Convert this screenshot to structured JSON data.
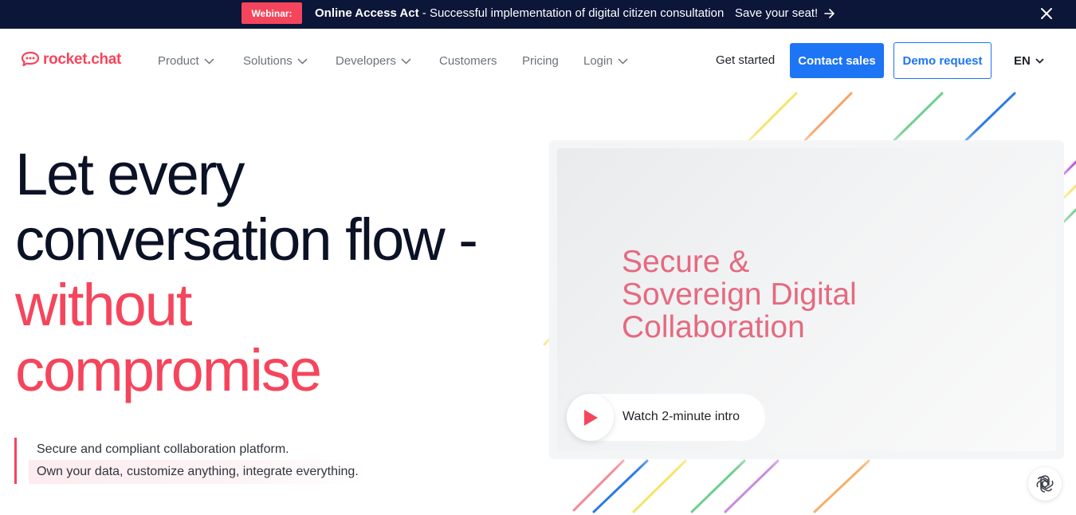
{
  "announcement": {
    "badge": "Webinar:",
    "title": "Online Access Act",
    "message": " - Successful implementation of digital citizen consultation",
    "cta": "Save your seat!",
    "close_icon": "close-icon"
  },
  "header": {
    "logo_text": "rocket.chat",
    "nav": [
      {
        "label": "Product",
        "has_dropdown": true
      },
      {
        "label": "Solutions",
        "has_dropdown": true
      },
      {
        "label": "Developers",
        "has_dropdown": true
      },
      {
        "label": "Customers",
        "has_dropdown": false
      },
      {
        "label": "Pricing",
        "has_dropdown": false
      },
      {
        "label": "Login",
        "has_dropdown": true
      }
    ],
    "get_started": "Get started",
    "contact_sales": "Contact sales",
    "demo_request": "Demo request",
    "language": "EN"
  },
  "hero": {
    "title_line1": "Let every",
    "title_line2": "conversation flow -",
    "title_line3": "without",
    "title_line4": "compromise",
    "sub_line1": "Secure and compliant collaboration platform.",
    "sub_line2": "Own your data, customize anything, integrate everything."
  },
  "video": {
    "headline_line1": "Secure &",
    "headline_line2": "Sovereign Digital",
    "headline_line3": "Collaboration",
    "play_label": "Watch 2-minute intro"
  },
  "colors": {
    "brand_red": "#f5455c",
    "brand_blue": "#1d74f5",
    "announce_bg": "#0b1638",
    "headline_pink": "#e46a80"
  }
}
